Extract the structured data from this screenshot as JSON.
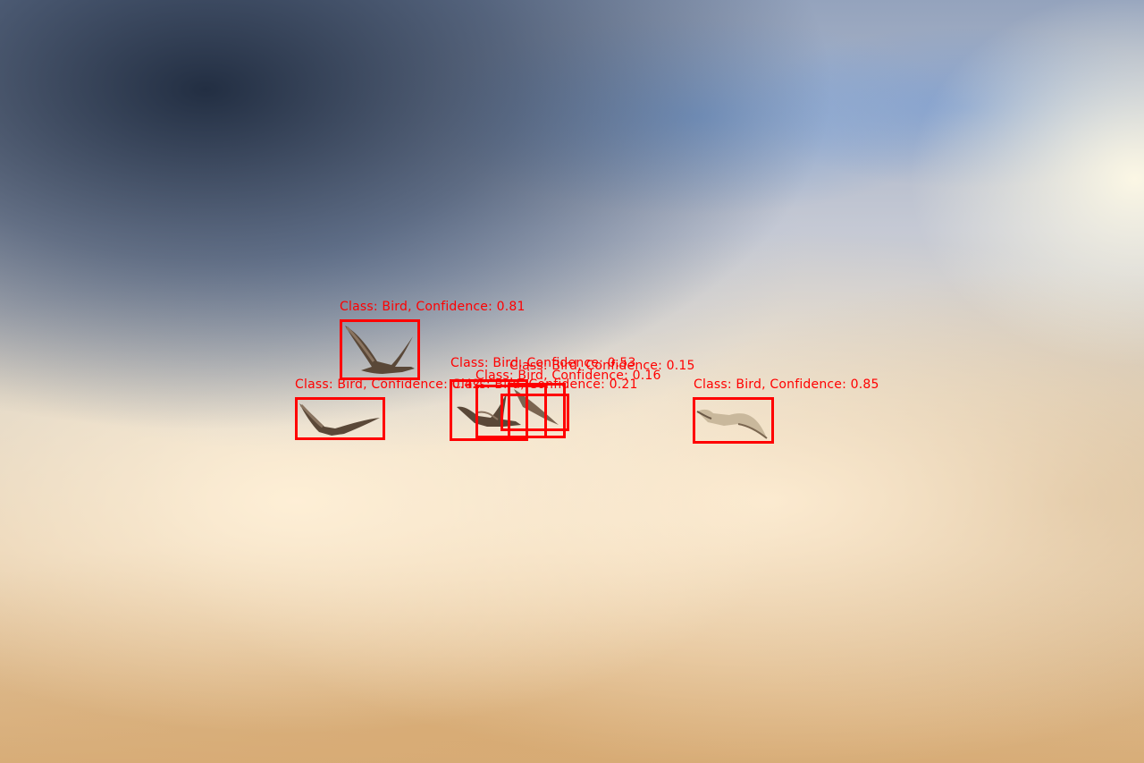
{
  "colors": {
    "box_stroke": "#ff0000",
    "label_text": "#ff0000",
    "bird_body": "#5a4838",
    "bird_wing_light": "#8a7460"
  },
  "detections": [
    {
      "class": "Bird",
      "confidence": 0.81,
      "label": "Class: Bird, Confidence: 0.81"
    },
    {
      "class": "Bird",
      "confidence": 0.53,
      "label": "Class: Bird, Confidence: 0.53"
    },
    {
      "class": "Bird",
      "confidence": 0.15,
      "label": "Class: Bird, Confidence: 0.15"
    },
    {
      "class": "Bird",
      "confidence": 0.16,
      "label": "Class: Bird, Confidence: 0.16"
    },
    {
      "class": "Bird",
      "confidence": 0.21,
      "label": "Class: Bird, Confidence: 0.21"
    },
    {
      "class": "Bird",
      "confidence": 0.42,
      "label": "Class: Bird, Confidence: 0.42"
    },
    {
      "class": "Bird",
      "confidence": 0.85,
      "label": "Class: Bird, Confidence: 0.85"
    }
  ]
}
